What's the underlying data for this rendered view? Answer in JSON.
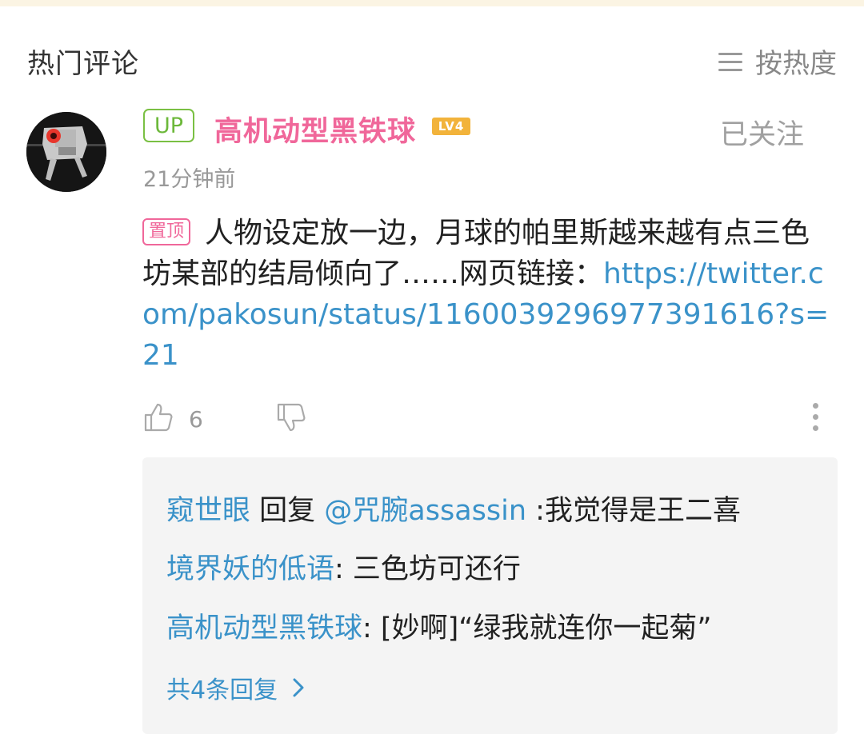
{
  "section": {
    "title": "热门评论",
    "sort_label": "按热度"
  },
  "comment": {
    "up_badge": "UP",
    "username": "高机动型黑铁球",
    "level": "LV4",
    "follow_label": "已关注",
    "time": "21分钟前",
    "pin_label": "置顶",
    "text": "人物设定放一边，月球的帕里斯越来越有点三色坊某部的结局倾向了……网页链接：",
    "link": "https://twitter.com/pakosun/status/1160039296977391616?s=21",
    "likes": "6"
  },
  "replies": [
    {
      "name": "窥世眼",
      "verb": " 回复 ",
      "target": "@咒腕assassin",
      "text": " :我觉得是王二喜"
    },
    {
      "name": "境界妖的低语",
      "verb": "",
      "target": "",
      "text": ": 三色坊可还行"
    },
    {
      "name": "高机动型黑铁球",
      "verb": "",
      "target": "",
      "text": ": [妙啊]“绿我就连你一起菊”"
    }
  ],
  "more_replies_label": "共4条回复",
  "colors": {
    "username_pink": "#f0679a",
    "link_blue": "#3a92c9",
    "up_green": "#7ac043",
    "level_orange": "#f2b33b"
  }
}
